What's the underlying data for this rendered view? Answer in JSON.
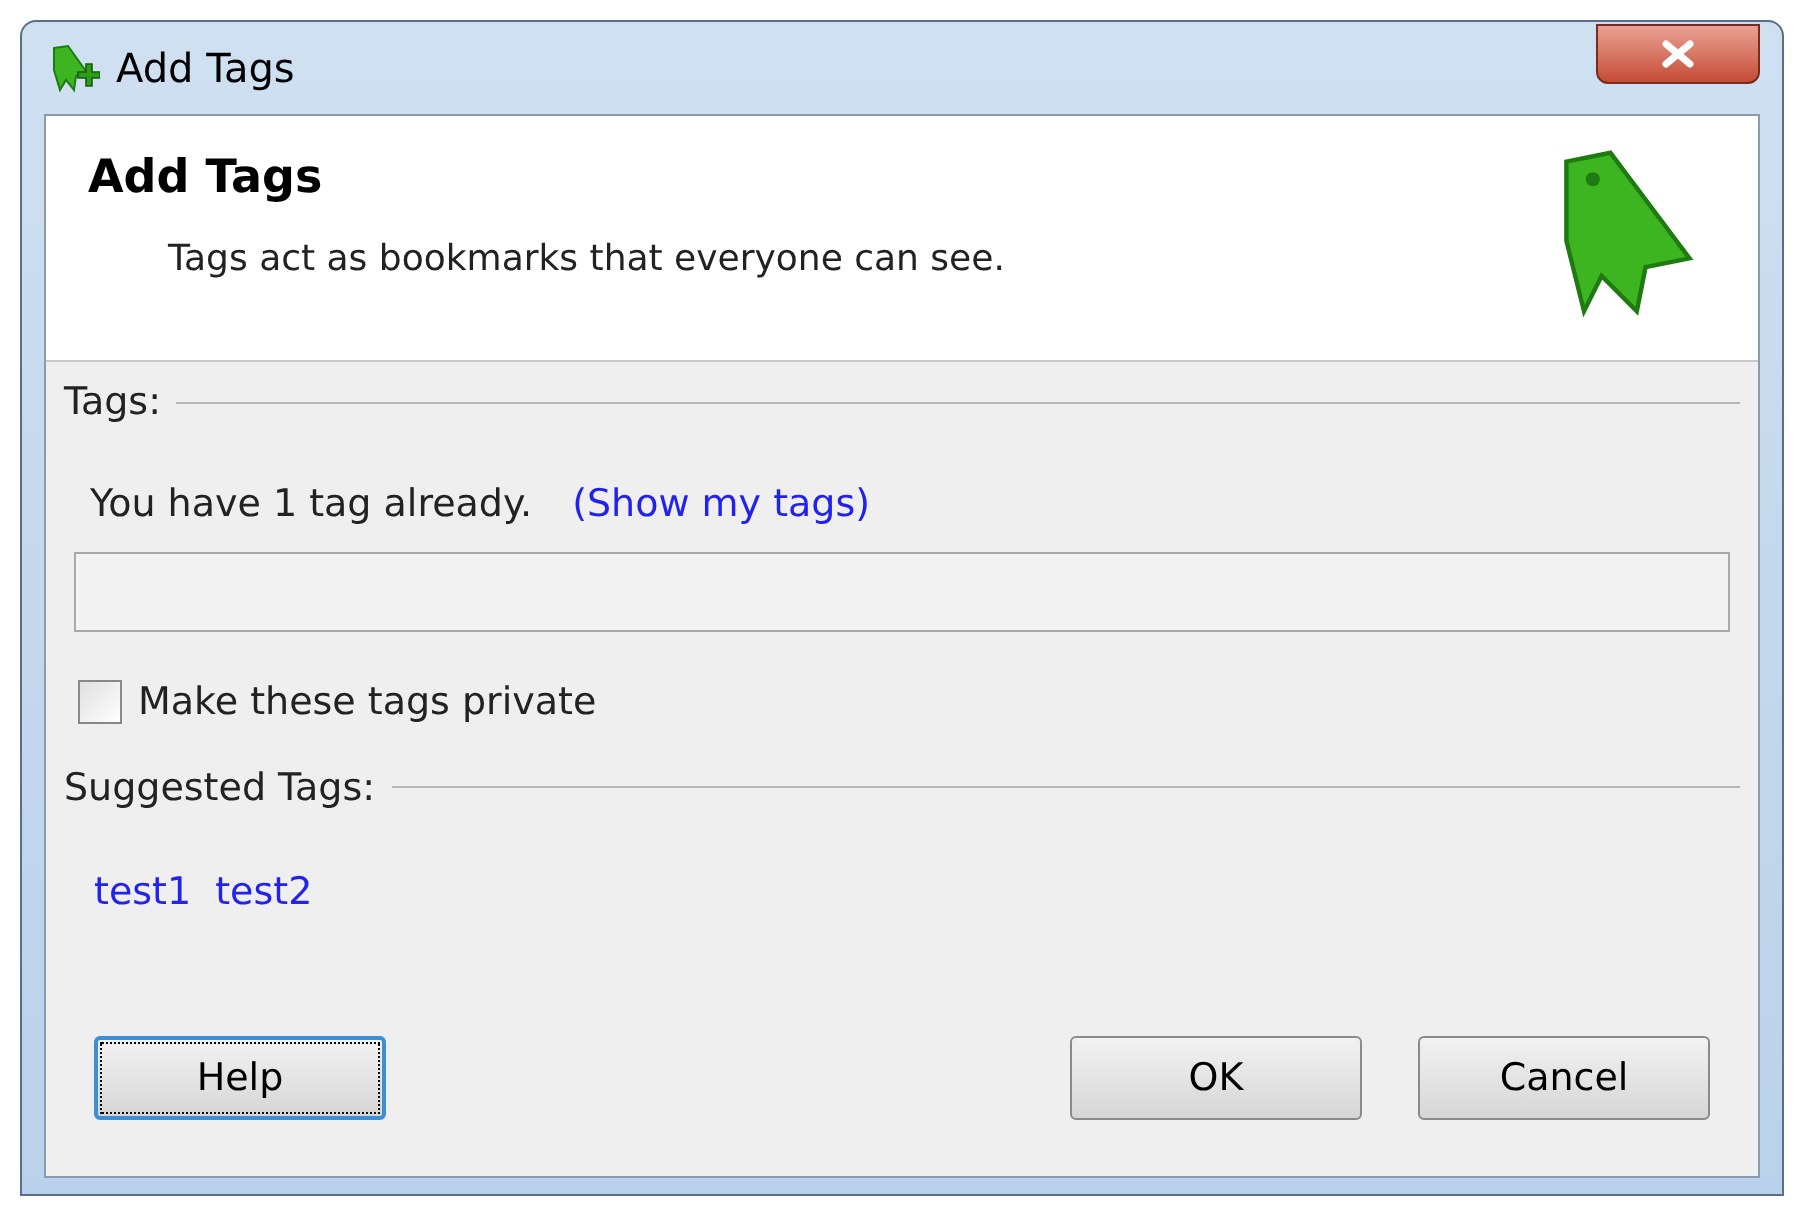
{
  "window": {
    "title": "Add Tags"
  },
  "header": {
    "title": "Add Tags",
    "description": "Tags act as bookmarks that everyone can see."
  },
  "tags_section": {
    "label": "Tags:",
    "info": "You have 1 tag already.",
    "link": "(Show my tags)"
  },
  "private_checkbox": {
    "label": "Make these tags private",
    "checked": false
  },
  "suggested_section": {
    "label": "Suggested Tags:",
    "tags": [
      "test1",
      "test2"
    ]
  },
  "buttons": [
    {
      "label": "Help",
      "focused": true
    },
    {
      "label": "OK",
      "focused": false
    },
    {
      "label": "Cancel",
      "focused": false
    }
  ]
}
